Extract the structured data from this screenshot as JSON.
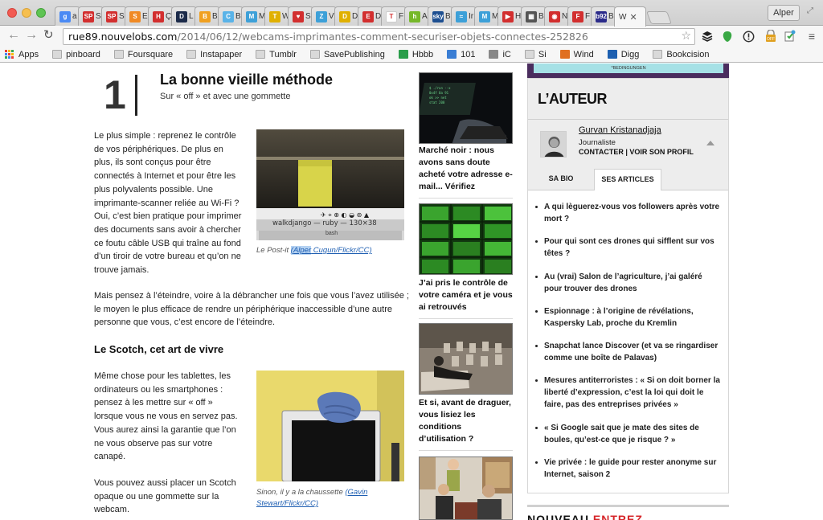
{
  "browser": {
    "tabs": [
      {
        "icon": "google-icon",
        "letter": "g",
        "color": "#4a8af4",
        "label": "a"
      },
      {
        "icon": "sp-icon",
        "letter": "SP",
        "color": "#d22f2f",
        "label": "S"
      },
      {
        "icon": "sp-icon",
        "letter": "SP",
        "color": "#d22f2f",
        "label": "S"
      },
      {
        "icon": "s-icon",
        "letter": "S",
        "color": "#f08a24",
        "label": "E"
      },
      {
        "icon": "h-icon",
        "letter": "H",
        "color": "#d22f2f",
        "label": "Ç"
      },
      {
        "icon": "d-icon",
        "letter": "D",
        "color": "#1c2b4a",
        "label": "L"
      },
      {
        "icon": "bird-icon",
        "letter": "B",
        "color": "#f0a020",
        "label": "B"
      },
      {
        "icon": "c-icon",
        "letter": "C",
        "color": "#5ab3e8",
        "label": "B"
      },
      {
        "icon": "m-icon",
        "letter": "M",
        "color": "#3da0d8",
        "label": "M"
      },
      {
        "icon": "tag-icon",
        "letter": "T",
        "color": "#e0b000",
        "label": "W"
      },
      {
        "icon": "heart-icon",
        "letter": "♥",
        "color": "#d22f2f",
        "label": "S"
      },
      {
        "icon": "z-icon",
        "letter": "Z",
        "color": "#3da0d8",
        "label": "V"
      },
      {
        "icon": "d-icon",
        "letter": "D",
        "color": "#e0b000",
        "label": "D"
      },
      {
        "icon": "e-icon",
        "letter": "E",
        "color": "#d22f2f",
        "label": "D"
      },
      {
        "icon": "t-icon",
        "letter": "T",
        "color": "#ffffff",
        "label": "F"
      },
      {
        "icon": "h-icon",
        "letter": "h",
        "color": "#76b82a",
        "label": "A"
      },
      {
        "icon": "sky-icon",
        "letter": "sky",
        "color": "#1d4f91",
        "label": "B"
      },
      {
        "icon": "wave-icon",
        "letter": "≈",
        "color": "#3da0d8",
        "label": "Ir"
      },
      {
        "icon": "m-icon",
        "letter": "M",
        "color": "#3da0d8",
        "label": "M"
      },
      {
        "icon": "play-icon",
        "letter": "▶",
        "color": "#d22f2f",
        "label": "H"
      },
      {
        "icon": "grid-icon",
        "letter": "▦",
        "color": "#555555",
        "label": "B"
      },
      {
        "icon": "ring-icon",
        "letter": "◉",
        "color": "#d22f2f",
        "label": "N"
      },
      {
        "icon": "f-icon",
        "letter": "F",
        "color": "#d22f2f",
        "label": "F"
      },
      {
        "icon": "b-icon",
        "letter": "b92",
        "color": "#2b2b8a",
        "label": "B"
      }
    ],
    "active_tab_label": "W",
    "profile_label": "Alper",
    "url_host": "rue89.nouvelobs.com",
    "url_path": "/2014/06/12/webcams-imprimantes-comment-securiser-objets-connectes-252826",
    "bookmarks": [
      {
        "label": "Apps",
        "icon": "apps-icon"
      },
      {
        "label": "pinboard",
        "icon": "folder-icon"
      },
      {
        "label": "Foursquare",
        "icon": "folder-icon"
      },
      {
        "label": "Instapaper",
        "icon": "folder-icon"
      },
      {
        "label": "Tumblr",
        "icon": "folder-icon"
      },
      {
        "label": "SavePublishing",
        "icon": "folder-icon"
      },
      {
        "label": "Hbbb",
        "icon": "drive-icon"
      },
      {
        "label": "101",
        "icon": "t-icon"
      },
      {
        "label": "iC",
        "icon": "ic-icon"
      },
      {
        "label": "Si",
        "icon": "folder-icon"
      },
      {
        "label": "Wind",
        "icon": "wind-icon"
      },
      {
        "label": "Digg",
        "icon": "digg-icon"
      },
      {
        "label": "Bookcision",
        "icon": "folder-icon"
      }
    ]
  },
  "article": {
    "section_number": "1",
    "section_title": "La bonne vieille méthode",
    "section_subtitle": "Sur « off » et avec une gommette",
    "para1": [
      "Le plus simple : reprenez le contrôle",
      "de vos périphériques. De plus en",
      "plus, ils sont conçus pour être",
      "connectés à Internet et pour être les",
      "plus polyvalents possible. Une",
      "imprimante-scanner reliée au Wi-Fi ?",
      "Oui, c’est bien pratique pour imprimer",
      "des documents sans avoir à chercher",
      "ce foutu câble USB qui traîne au fond",
      "d’un tiroir de votre bureau et qu’on ne",
      "trouve jamais."
    ],
    "para2": [
      "Mais pensez à l’éteindre, voire à la débrancher une fois que vous l’avez utilisée ;",
      "le moyen le plus efficace de rendre un périphérique inaccessible d’une autre",
      "personne que vous, c’est encore de l’éteindre."
    ],
    "heading2": "Le Scotch, cet art de vivre",
    "para3": [
      "Même chose pour les tablettes, les",
      "ordinateurs ou les smartphones :",
      "pensez à les mettre sur « off »",
      "lorsque vous ne vous en servez pas.",
      "Vous aurez ainsi la garantie que l’on",
      "ne vous observe pas sur votre",
      "canapé."
    ],
    "para4": [
      "Vous pouvez aussi placer un Scotch",
      "opaque ou une gommette sur la",
      "webcam."
    ],
    "image1": {
      "terminal_text": "walkdjango — ruby — 130×38",
      "terminal_tab": "bash",
      "caption_text": "Le Post-it ",
      "caption_sel": "(Alper",
      "caption_link": " Cugun/Flickr/CC)"
    },
    "image2": {
      "caption_line1": "Sinon, il y a la chaussette ",
      "caption_link1": "(Gavin",
      "caption_link2": "Stewart/Flickr/CC)"
    }
  },
  "related": [
    {
      "title": "Marché noir : nous avons sans doute acheté votre adresse e-mail... Vérifiez",
      "lines": [
        "Marché noir : nous",
        "avons sans doute",
        "acheté votre adresse e-",
        "mail... Vérifiez"
      ]
    },
    {
      "title": "J’ai pris le contrôle de votre caméra et je vous ai retrouvés",
      "lines": [
        "J’ai pris le contrôle de",
        "votre caméra et je vous",
        "ai retrouvés"
      ]
    },
    {
      "title": "Et si, avant de draguer, vous lisiez les conditions d’utilisation ?",
      "lines": [
        "Et si, avant de draguer,",
        "vous lisiez les",
        "conditions",
        "d’utilisation ?"
      ]
    }
  ],
  "sidebar": {
    "ad_text": "*BEDINGUNGEN",
    "heading": "L’AUTEUR",
    "author_name": "Gurvan Kristanadjaja",
    "author_role": "Journaliste",
    "author_links": "CONTACTER | VOIR SON PROFIL",
    "tab_bio": "SA BIO",
    "tab_articles": "SES ARTICLES",
    "articles": [
      [
        "A qui lèguerez-vous vos followers après votre",
        "mort ?"
      ],
      [
        "Pour qui sont ces drones qui sifflent sur vos",
        "têtes ?"
      ],
      [
        "Au (vrai) Salon de l’agriculture, j’ai galéré",
        "pour trouver des drones"
      ],
      [
        "Espionnage : à l’origine de révélations,",
        "Kaspersky Lab, proche du Kremlin"
      ],
      [
        "Snapchat lance Discover (et va se ringardiser",
        "comme une boîte de Palavas)"
      ],
      [
        "Mesures antiterroristes : « Si on doit borner la",
        "liberté d’expression, c’est la loi qui doit le",
        "faire, pas des entreprises privées »"
      ],
      [
        "« Si Google sait que je mate des sites de",
        "boules, qu’est-ce que je risque ? »"
      ],
      [
        "Vie privée : le guide pour rester anonyme sur",
        "Internet, saison 2"
      ]
    ],
    "bottom_label_a": "NOUVEAU",
    "bottom_label_b": "ENTREZ"
  },
  "colors": {
    "link": "#1f5fb2",
    "sidebar_bg": "#ededed",
    "ad_purple": "#4a2d5e",
    "ad_cyan": "#a6e1e6"
  }
}
